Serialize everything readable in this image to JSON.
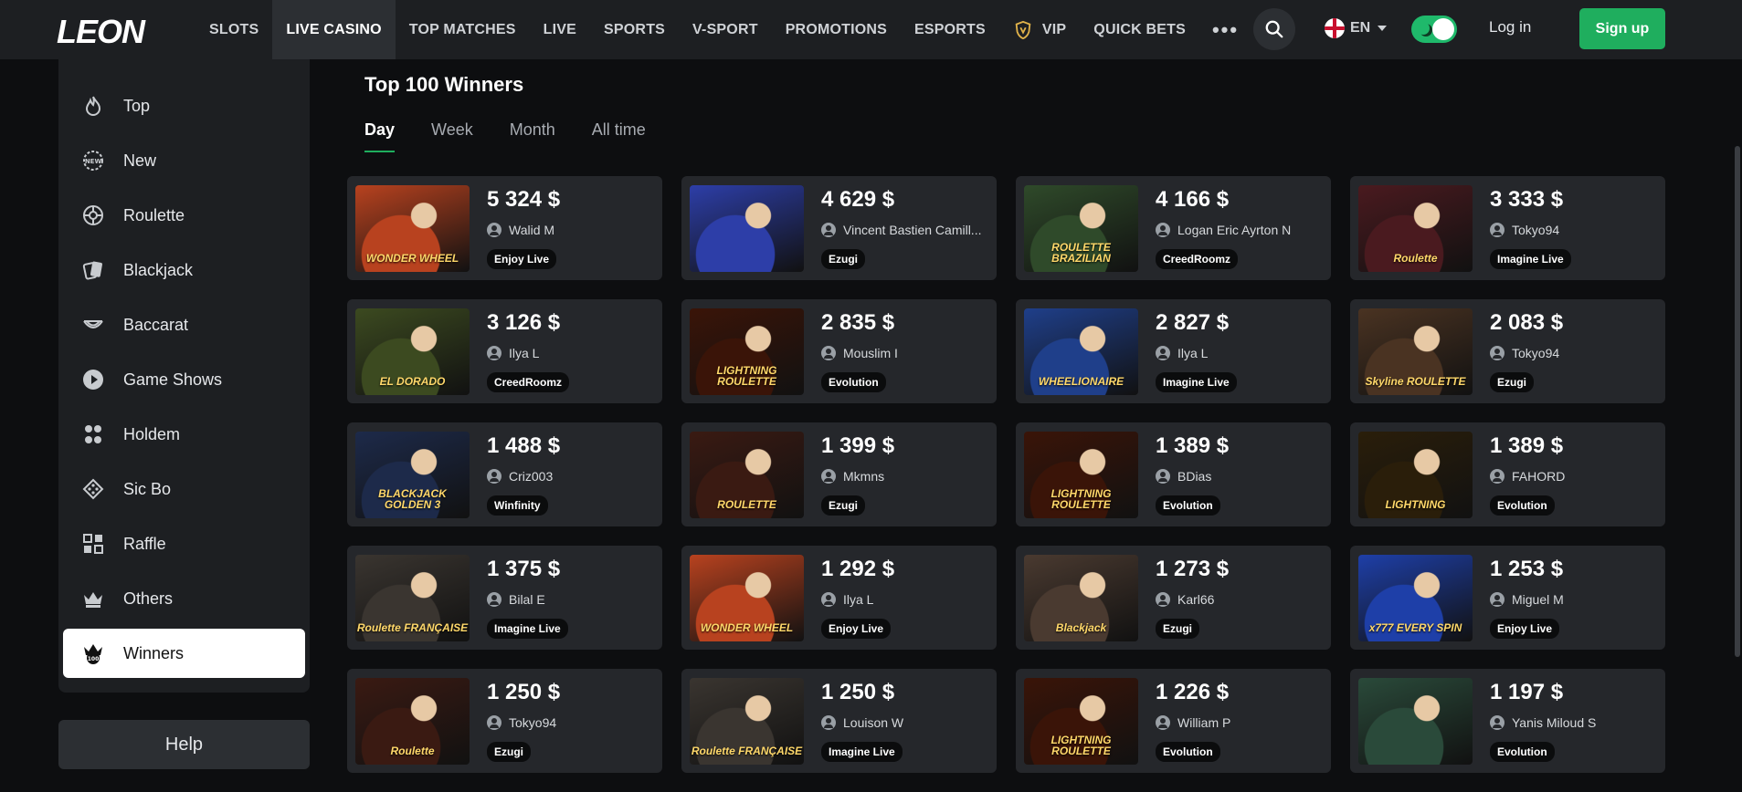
{
  "header": {
    "logo": "LEON",
    "nav": [
      {
        "label": "SLOTS",
        "active": false
      },
      {
        "label": "LIVE CASINO",
        "active": true
      },
      {
        "label": "TOP MATCHES",
        "active": false
      },
      {
        "label": "LIVE",
        "active": false
      },
      {
        "label": "SPORTS",
        "active": false
      },
      {
        "label": "V-SPORT",
        "active": false
      },
      {
        "label": "PROMOTIONS",
        "active": false
      },
      {
        "label": "ESPORTS",
        "active": false
      },
      {
        "label": "VIP",
        "active": false
      },
      {
        "label": "QUICK BETS",
        "active": false
      }
    ],
    "language": "EN",
    "login_label": "Log in",
    "signup_label": "Sign up"
  },
  "sidebar": {
    "items": [
      {
        "label": "Top",
        "icon": "fire-icon"
      },
      {
        "label": "New",
        "icon": "new-badge-icon"
      },
      {
        "label": "Roulette",
        "icon": "roulette-icon"
      },
      {
        "label": "Blackjack",
        "icon": "cards-icon"
      },
      {
        "label": "Baccarat",
        "icon": "baccarat-icon"
      },
      {
        "label": "Game Shows",
        "icon": "play-icon"
      },
      {
        "label": "Holdem",
        "icon": "holdem-icon"
      },
      {
        "label": "Sic Bo",
        "icon": "dice-icon"
      },
      {
        "label": "Raffle",
        "icon": "raffle-icon"
      },
      {
        "label": "Others",
        "icon": "crown-icon"
      },
      {
        "label": "Winners",
        "icon": "top100-icon",
        "active": true
      }
    ],
    "help_label": "Help"
  },
  "main": {
    "title": "Top 100 Winners",
    "tabs": [
      {
        "label": "Day",
        "active": true
      },
      {
        "label": "Week",
        "active": false
      },
      {
        "label": "Month",
        "active": false
      },
      {
        "label": "All time",
        "active": false
      }
    ],
    "winners": [
      {
        "amount": "5 324 $",
        "user": "Walid M",
        "provider": "Enjoy Live",
        "game": "WONDER WHEEL",
        "color": "#b8421f"
      },
      {
        "amount": "4 629 $",
        "user": "Vincent Bastien Camill...",
        "provider": "Ezugi",
        "game": "",
        "color": "#2d3ea8"
      },
      {
        "amount": "4 166 $",
        "user": "Logan Eric Ayrton N",
        "provider": "CreedRoomz",
        "game": "ROULETTE BRAZILIAN",
        "color": "#2f4a2a"
      },
      {
        "amount": "3 333 $",
        "user": "Tokyo94",
        "provider": "Imagine Live",
        "game": "Roulette",
        "color": "#4a1a1f"
      },
      {
        "amount": "3 126 $",
        "user": "Ilya L",
        "provider": "CreedRoomz",
        "game": "EL DORADO",
        "color": "#3c4a20"
      },
      {
        "amount": "2 835 $",
        "user": "Mouslim I",
        "provider": "Evolution",
        "game": "LIGHTNING ROULETTE",
        "color": "#3a1408"
      },
      {
        "amount": "2 827 $",
        "user": "Ilya L",
        "provider": "Imagine Live",
        "game": "WHEELIONAIRE",
        "color": "#1f3f8a"
      },
      {
        "amount": "2 083 $",
        "user": "Tokyo94",
        "provider": "Ezugi",
        "game": "Skyline ROULETTE",
        "color": "#4a3322"
      },
      {
        "amount": "1 488 $",
        "user": "Criz003",
        "provider": "Winfinity",
        "game": "BLACKJACK GOLDEN 3",
        "color": "#1d2a4a"
      },
      {
        "amount": "1 399 $",
        "user": "Mkmns",
        "provider": "Ezugi",
        "game": "ROULETTE",
        "color": "#3a1a12"
      },
      {
        "amount": "1 389 $",
        "user": "BDias",
        "provider": "Evolution",
        "game": "LIGHTNING ROULETTE",
        "color": "#3a1408"
      },
      {
        "amount": "1 389 $",
        "user": "FAHORD",
        "provider": "Evolution",
        "game": "LIGHTNING",
        "color": "#2a1e0a"
      },
      {
        "amount": "1 375 $",
        "user": "Bilal E",
        "provider": "Imagine Live",
        "game": "Roulette FRANÇAISE",
        "color": "#3a3530"
      },
      {
        "amount": "1 292 $",
        "user": "Ilya L",
        "provider": "Enjoy Live",
        "game": "WONDER WHEEL",
        "color": "#b8421f"
      },
      {
        "amount": "1 273 $",
        "user": "Karl66",
        "provider": "Ezugi",
        "game": "Blackjack",
        "color": "#4a3a30"
      },
      {
        "amount": "1 253 $",
        "user": "Miguel M",
        "provider": "Enjoy Live",
        "game": "x777 EVERY SPIN",
        "color": "#1e3fa8"
      },
      {
        "amount": "1 250 $",
        "user": "Tokyo94",
        "provider": "Ezugi",
        "game": "Roulette",
        "color": "#3a1a12"
      },
      {
        "amount": "1 250 $",
        "user": "Louison W",
        "provider": "Imagine Live",
        "game": "Roulette FRANÇAISE",
        "color": "#3a3530"
      },
      {
        "amount": "1 226 $",
        "user": "William P",
        "provider": "Evolution",
        "game": "LIGHTNING ROULETTE",
        "color": "#3a1408"
      },
      {
        "amount": "1 197 $",
        "user": "Yanis Miloud S",
        "provider": "Evolution",
        "game": "",
        "color": "#2a4a3a"
      }
    ]
  }
}
